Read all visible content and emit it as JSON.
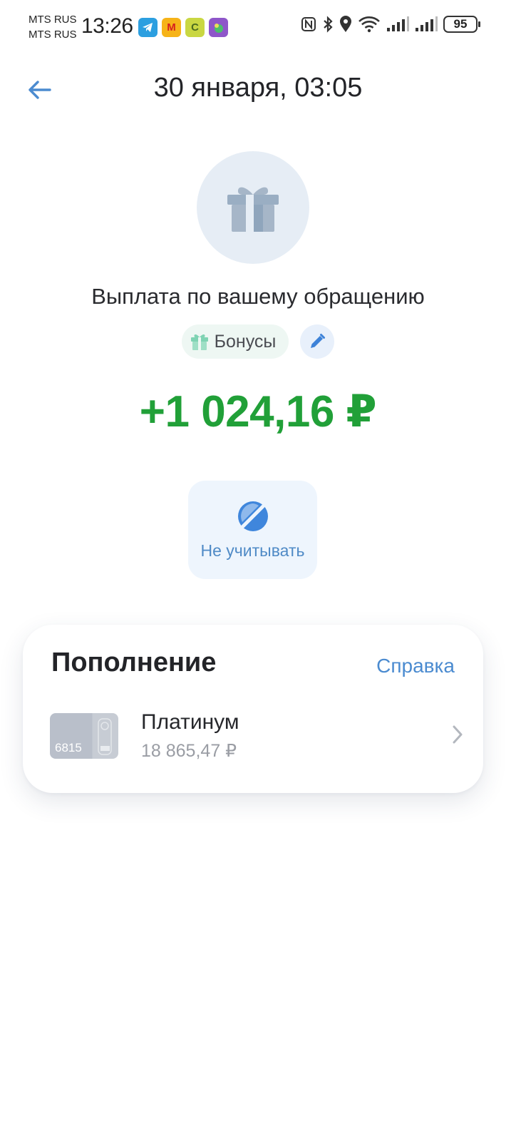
{
  "status_bar": {
    "carrier_1": "MTS RUS",
    "carrier_2": "MTS RUS",
    "time": "13:26",
    "battery": "95",
    "app_icons": [
      "telegram-icon",
      "megamarket-icon",
      "c-app-icon",
      "game-app-icon"
    ],
    "system_icons": [
      "nfc-icon",
      "bluetooth-icon",
      "location-icon",
      "wifi-icon",
      "signal-icon",
      "signal-icon"
    ]
  },
  "header": {
    "title": "30 января, 03:05"
  },
  "transaction": {
    "description": "Выплата по вашему обращению",
    "category": "Бонусы",
    "amount": "+1 024,16 ₽",
    "amount_color": "#21a038",
    "exclude_label": "Не учитывать"
  },
  "top_up": {
    "title": "Пополнение",
    "help_label": "Справка",
    "account": {
      "card_last_digits": "6815",
      "name": "Платинум",
      "balance": "18 865,47 ₽"
    }
  },
  "colors": {
    "accent": "#4b8bd0",
    "positive": "#21a038"
  }
}
